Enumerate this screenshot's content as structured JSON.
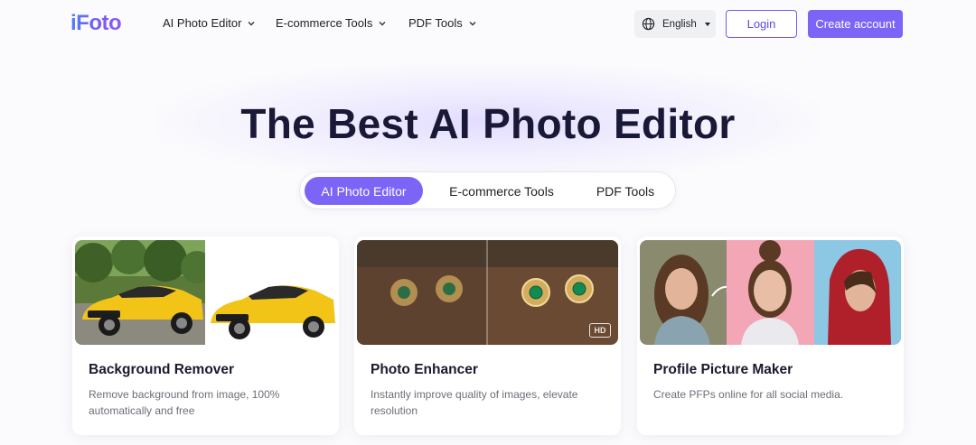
{
  "nav": {
    "logo": "iFoto",
    "items": [
      {
        "label": "AI Photo Editor"
      },
      {
        "label": "E-commerce Tools"
      },
      {
        "label": "PDF Tools"
      }
    ],
    "language": "English",
    "login_label": "Login",
    "create_account_label": "Create account"
  },
  "hero": {
    "title": "The Best AI Photo Editor"
  },
  "tabs": [
    {
      "label": "AI Photo Editor",
      "active": true
    },
    {
      "label": "E-commerce Tools",
      "active": false
    },
    {
      "label": "PDF Tools",
      "active": false
    }
  ],
  "cards": [
    {
      "title": "Background Remover",
      "description": "Remove background from image, 100% automatically and free"
    },
    {
      "title": "Photo Enhancer",
      "description": "Instantly improve quality of images, elevate resolution",
      "badge": "HD"
    },
    {
      "title": "Profile Picture Maker",
      "description": "Create PFPs online for all social media."
    }
  ],
  "colors": {
    "accent": "#7c64f6",
    "title": "#191937",
    "text_muted": "#6d6d7a"
  }
}
